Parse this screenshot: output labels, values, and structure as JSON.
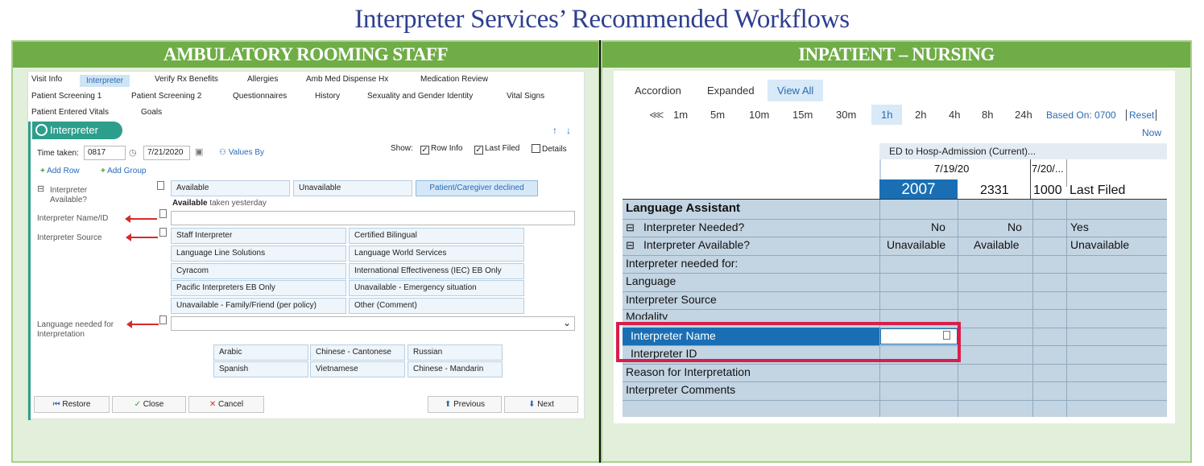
{
  "title": "Interpreter Services’ Recommended Workflows",
  "left": {
    "header": "AMBULATORY ROOMING STAFF",
    "nav_row1": [
      "Visit Info",
      "Interpreter",
      "Verify Rx Benefits",
      "Allergies",
      "Amb Med Dispense Hx",
      "Medication Review"
    ],
    "nav_row2": [
      "Patient Screening 1",
      "Patient Screening 2",
      "Questionnaires",
      "History",
      "Sexuality and Gender Identity",
      "Vital Signs"
    ],
    "nav_row3": [
      "Patient Entered Vitals",
      "Goals"
    ],
    "section_title": "Interpreter",
    "time_taken_label": "Time taken:",
    "time_value": "0817",
    "date_value": "7/21/2020",
    "values_by": "Values By",
    "show_label": "Show:",
    "row_info": "Row Info",
    "last_filed": "Last Filed",
    "details": "Details",
    "add_row": "Add Row",
    "add_group": "Add Group",
    "interpreter_available_label": "Interpreter Available?",
    "available_options": [
      "Available",
      "Unavailable",
      "Patient/Caregiver declined"
    ],
    "available_note_bold": "Available",
    "available_note_rest": "taken yesterday",
    "name_id_label": "Interpreter Name/ID",
    "source_label": "Interpreter Source",
    "source_options": [
      "Staff Interpreter",
      "Certified Bilingual",
      "Language Line Solutions",
      "Language World Services",
      "Cyracom",
      "International Effectiveness (IEC) EB Only",
      "Pacific Interpreters EB Only",
      "Unavailable - Emergency situation",
      "Unavailable - Family/Friend (per policy)",
      "Other (Comment)"
    ],
    "language_label": "Language needed for Interpretation",
    "language_options": [
      "Arabic",
      "Chinese - Cantonese",
      "Russian",
      "Spanish",
      "Vietnamese",
      "Chinese - Mandarin"
    ],
    "buttons": {
      "restore": "Restore",
      "close": "Close",
      "cancel": "Cancel",
      "previous": "Previous",
      "next": "Next"
    }
  },
  "right": {
    "header": "INPATIENT – NURSING",
    "tabs": [
      "Accordion",
      "Expanded",
      "View All"
    ],
    "times": [
      "1m",
      "5m",
      "10m",
      "15m",
      "30m",
      "1h",
      "2h",
      "4h",
      "8h",
      "24h"
    ],
    "based_on": "Based On: 0700",
    "reset": "Reset",
    "now": "Now",
    "encounter": "ED to Hosp-Admission (Current)...",
    "date1": "7/19/20",
    "date2": "7/20/...",
    "col_times": [
      "2007",
      "2331",
      "1000"
    ],
    "last_filed": "Last Filed",
    "group": "Language Assistant",
    "rows": [
      "Interpreter Needed?",
      "Interpreter Available?",
      "Interpreter needed for:",
      "Language",
      "Interpreter Source",
      "Modality",
      "Interpreter Name",
      "Interpreter ID",
      "Reason for Interpretation",
      "Interpreter Comments"
    ],
    "needed_values": [
      "No",
      "No",
      "Yes"
    ],
    "available_values": [
      "Unavailable",
      "Available",
      "Unavailable"
    ]
  }
}
